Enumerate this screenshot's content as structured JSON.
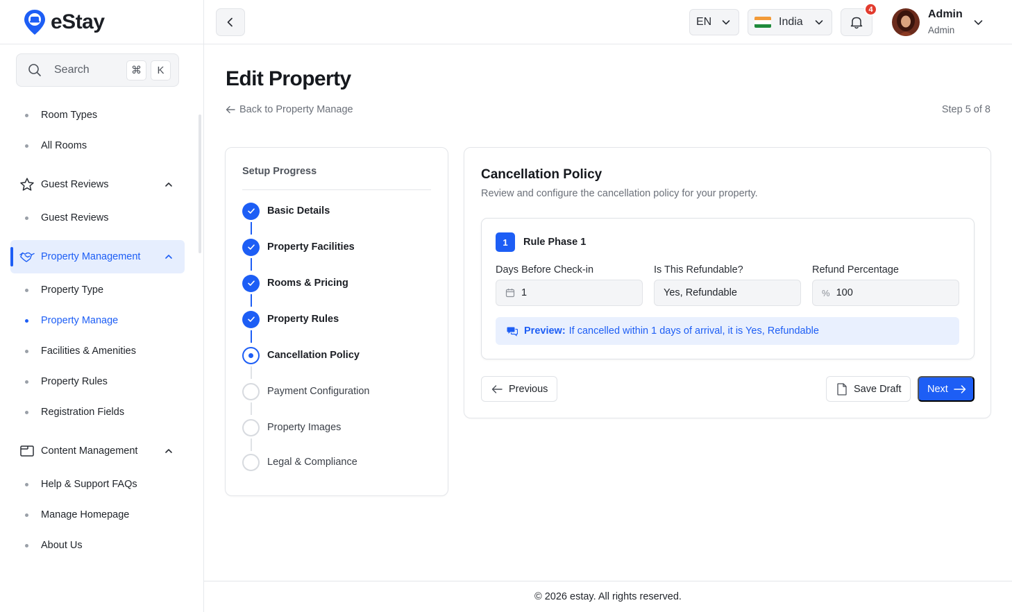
{
  "brand": {
    "name": "eStay",
    "accent": "#1d5ef5"
  },
  "sidebar": {
    "search": {
      "label": "Search",
      "shortcut_mod": "⌘",
      "shortcut_key": "K"
    },
    "items": [
      {
        "type": "sub",
        "label": "Room Types"
      },
      {
        "type": "sub",
        "label": "All Rooms"
      },
      {
        "type": "group",
        "label": "Guest Reviews",
        "icon": "star-icon"
      },
      {
        "type": "sub",
        "label": "Guest Reviews"
      },
      {
        "type": "group",
        "label": "Property Management",
        "icon": "handshake-icon",
        "active": true
      },
      {
        "type": "sub",
        "label": "Property Type"
      },
      {
        "type": "sub",
        "label": "Property Manage",
        "active": true
      },
      {
        "type": "sub",
        "label": "Facilities & Amenities"
      },
      {
        "type": "sub",
        "label": "Property Rules"
      },
      {
        "type": "sub",
        "label": "Registration Fields"
      },
      {
        "type": "group",
        "label": "Content Management",
        "icon": "browser-icon"
      },
      {
        "type": "sub",
        "label": "Help & Support FAQs"
      },
      {
        "type": "sub",
        "label": "Manage Homepage"
      },
      {
        "type": "sub",
        "label": "About Us"
      }
    ]
  },
  "header": {
    "language": "EN",
    "country": "India",
    "notifications_count": "4",
    "user": {
      "name": "Admin",
      "role": "Admin"
    }
  },
  "page": {
    "title": "Edit Property",
    "back_link": "Back to Property Manage",
    "step_text": "Step 5 of 8"
  },
  "progress": {
    "heading": "Setup Progress",
    "steps": [
      {
        "label": "Basic Details",
        "status": "done"
      },
      {
        "label": "Property Facilities",
        "status": "done"
      },
      {
        "label": "Rooms & Pricing",
        "status": "done"
      },
      {
        "label": "Property Rules",
        "status": "done"
      },
      {
        "label": "Cancellation Policy",
        "status": "current"
      },
      {
        "label": "Payment Configuration",
        "status": "todo"
      },
      {
        "label": "Property Images",
        "status": "todo"
      },
      {
        "label": "Legal & Compliance",
        "status": "todo"
      }
    ]
  },
  "policy": {
    "title": "Cancellation Policy",
    "description": "Review and configure the cancellation policy for your property.",
    "rule": {
      "number": "1",
      "title": "Rule Phase 1",
      "days_label": "Days Before Check-in",
      "days_value": "1",
      "refundable_label": "Is This Refundable?",
      "refundable_value": "Yes, Refundable",
      "refund_label": "Refund Percentage",
      "refund_prefix": "%",
      "refund_value": "100",
      "preview_label": "Preview:",
      "preview_text": "If cancelled within 1 days of arrival, it is Yes, Refundable"
    },
    "buttons": {
      "previous": "Previous",
      "save_draft": "Save Draft",
      "next": "Next"
    }
  },
  "footer": {
    "text": "© 2026 estay. All rights reserved."
  }
}
